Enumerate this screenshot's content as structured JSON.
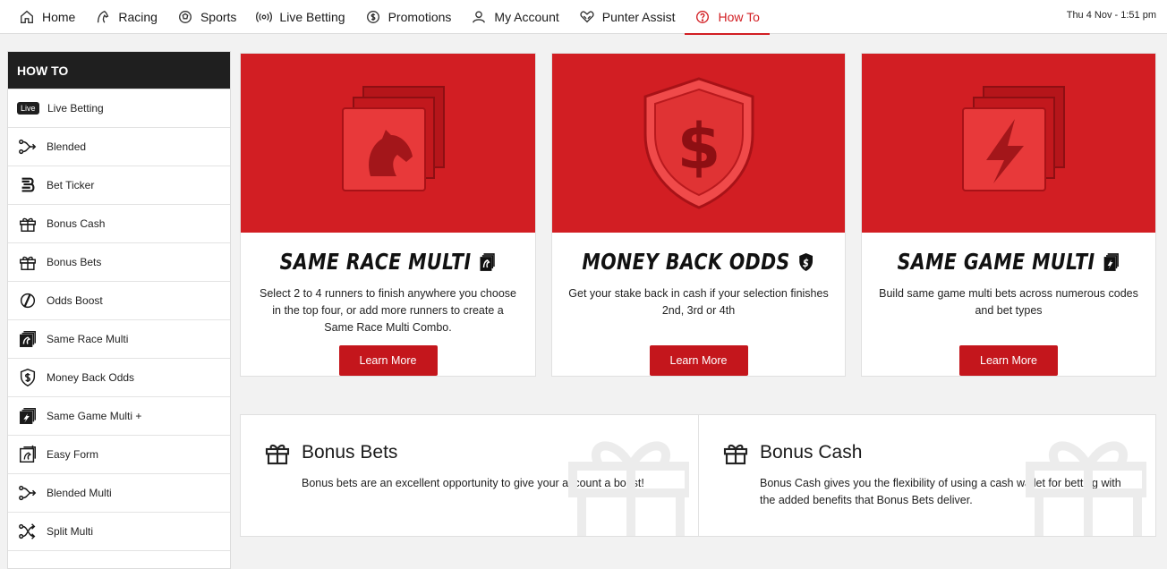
{
  "nav": {
    "items": [
      {
        "label": "Home",
        "icon": "home-icon"
      },
      {
        "label": "Racing",
        "icon": "horse-icon"
      },
      {
        "label": "Sports",
        "icon": "ball-icon"
      },
      {
        "label": "Live Betting",
        "icon": "broadcast-icon"
      },
      {
        "label": "Promotions",
        "icon": "dollar-circle-icon"
      },
      {
        "label": "My Account",
        "icon": "user-icon"
      },
      {
        "label": "Punter Assist",
        "icon": "heart-hands-icon"
      },
      {
        "label": "How To",
        "icon": "question-circle-icon"
      }
    ],
    "active": "How To",
    "clock": "Thu 4 Nov - 1:51 pm"
  },
  "sidebar": {
    "title": "HOW TO",
    "live_badge": "Live",
    "items": [
      {
        "label": "Live Betting",
        "icon": "live-badge"
      },
      {
        "label": "Blended",
        "icon": "blended-icon"
      },
      {
        "label": "Bet Ticker",
        "icon": "bet-ticker-icon"
      },
      {
        "label": "Bonus Cash",
        "icon": "gift-icon"
      },
      {
        "label": "Bonus Bets",
        "icon": "gift-icon"
      },
      {
        "label": "Odds Boost",
        "icon": "odds-boost-icon"
      },
      {
        "label": "Same Race Multi",
        "icon": "same-race-multi-icon"
      },
      {
        "label": "Money Back Odds",
        "icon": "shield-dollar-icon"
      },
      {
        "label": "Same Game Multi +",
        "icon": "same-game-multi-icon"
      },
      {
        "label": "Easy Form",
        "icon": "easy-form-icon"
      },
      {
        "label": "Blended Multi",
        "icon": "blended-multi-icon"
      },
      {
        "label": "Split Multi",
        "icon": "split-multi-icon"
      }
    ]
  },
  "cards": [
    {
      "title": "SAME RACE MULTI",
      "desc": "Select 2 to 4 runners to finish anywhere you choose in the top four, or add more runners to create a Same Race Multi Combo.",
      "button": "Learn More"
    },
    {
      "title": "MONEY BACK ODDS",
      "desc": "Get your stake back in cash if your selection finishes 2nd, 3rd or 4th",
      "button": "Learn More"
    },
    {
      "title": "SAME GAME MULTI",
      "desc": "Build same game multi bets across numerous codes and bet types",
      "button": "Learn More"
    }
  ],
  "bonus": {
    "bets": {
      "title": "Bonus Bets",
      "desc": "Bonus bets are an excellent opportunity to give your account a boost!"
    },
    "cash": {
      "title": "Bonus Cash",
      "desc": "Bonus Cash gives you the flexibility of using a cash wallet for betting with the added benefits that Bonus Bets deliver."
    }
  },
  "colors": {
    "brand_red": "#d21e23",
    "dark": "#1f1f1f"
  }
}
